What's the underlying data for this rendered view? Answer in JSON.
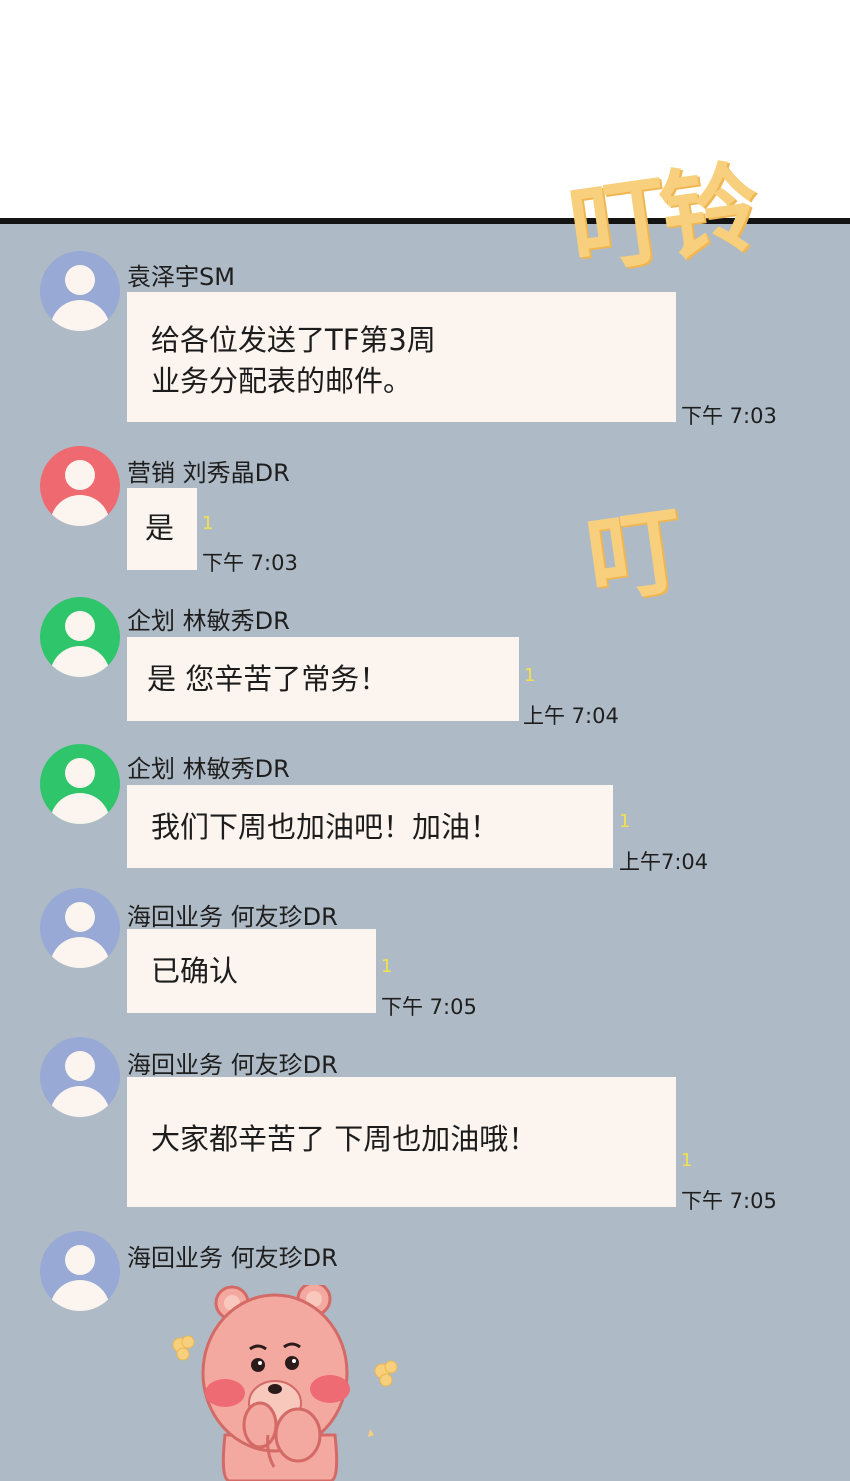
{
  "sound_effects": {
    "ding_ling": "叮铃",
    "ding": "叮"
  },
  "messages": [
    {
      "sender": "袁泽宇SM",
      "avatar": "person-icon-blue",
      "text": "给各位发送了TF第3周\n业务分配表的邮件。",
      "read_count": "",
      "time": "下午 7:03"
    },
    {
      "sender": "营销 刘秀晶DR",
      "avatar": "person-icon-red",
      "text": "是",
      "read_count": "1",
      "time": "下午 7:03"
    },
    {
      "sender": "企划 林敏秀DR",
      "avatar": "person-icon-green",
      "text": "是 您辛苦了常务！",
      "read_count": "1",
      "time": "上午 7:04"
    },
    {
      "sender": "企划 林敏秀DR",
      "avatar": "person-icon-green",
      "text": "我们下周也加油吧！加油！",
      "read_count": "1",
      "time": "上午7:04"
    },
    {
      "sender": "海回业务 何友珍DR",
      "avatar": "person-icon-blue",
      "text": "已确认",
      "read_count": "1",
      "time": "下午 7:05"
    },
    {
      "sender": "海回业务 何友珍DR",
      "avatar": "person-icon-blue",
      "text": "大家都辛苦了 下周也加油哦！",
      "read_count": "1",
      "time": "下午 7:05"
    },
    {
      "sender": "海回业务 何友珍DR",
      "avatar": "person-icon-blue",
      "sticker": "pink-bear-sticker"
    }
  ],
  "colors": {
    "chat_background": "#aebbc6",
    "bubble": "#fbf4ef",
    "read_indicator": "#f3e04c",
    "avatar_blue": "#97a9d4",
    "avatar_red": "#ef6a70",
    "avatar_green": "#2fc56a",
    "sfx": "#f8d07d"
  }
}
